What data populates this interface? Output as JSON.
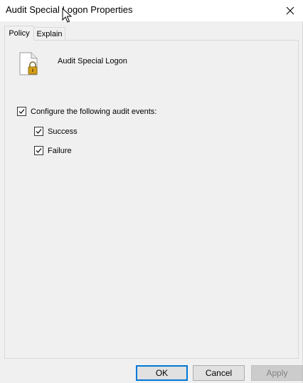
{
  "window": {
    "title": "Audit Special Logon Properties"
  },
  "tabs": [
    {
      "label": "Policy",
      "active": true
    },
    {
      "label": "Explain",
      "active": false
    }
  ],
  "policy": {
    "name": "Audit Special Logon",
    "icon": "document-lock-icon"
  },
  "options": {
    "configure": {
      "label": "Configure the following audit events:",
      "checked": true
    },
    "success": {
      "label": "Success",
      "checked": true
    },
    "failure": {
      "label": "Failure",
      "checked": true
    }
  },
  "buttons": {
    "ok": "OK",
    "cancel": "Cancel",
    "apply": "Apply"
  },
  "colors": {
    "dialog_bg": "#f0f0f0",
    "ok_border": "#0078d7",
    "lock": "#d4a017"
  }
}
